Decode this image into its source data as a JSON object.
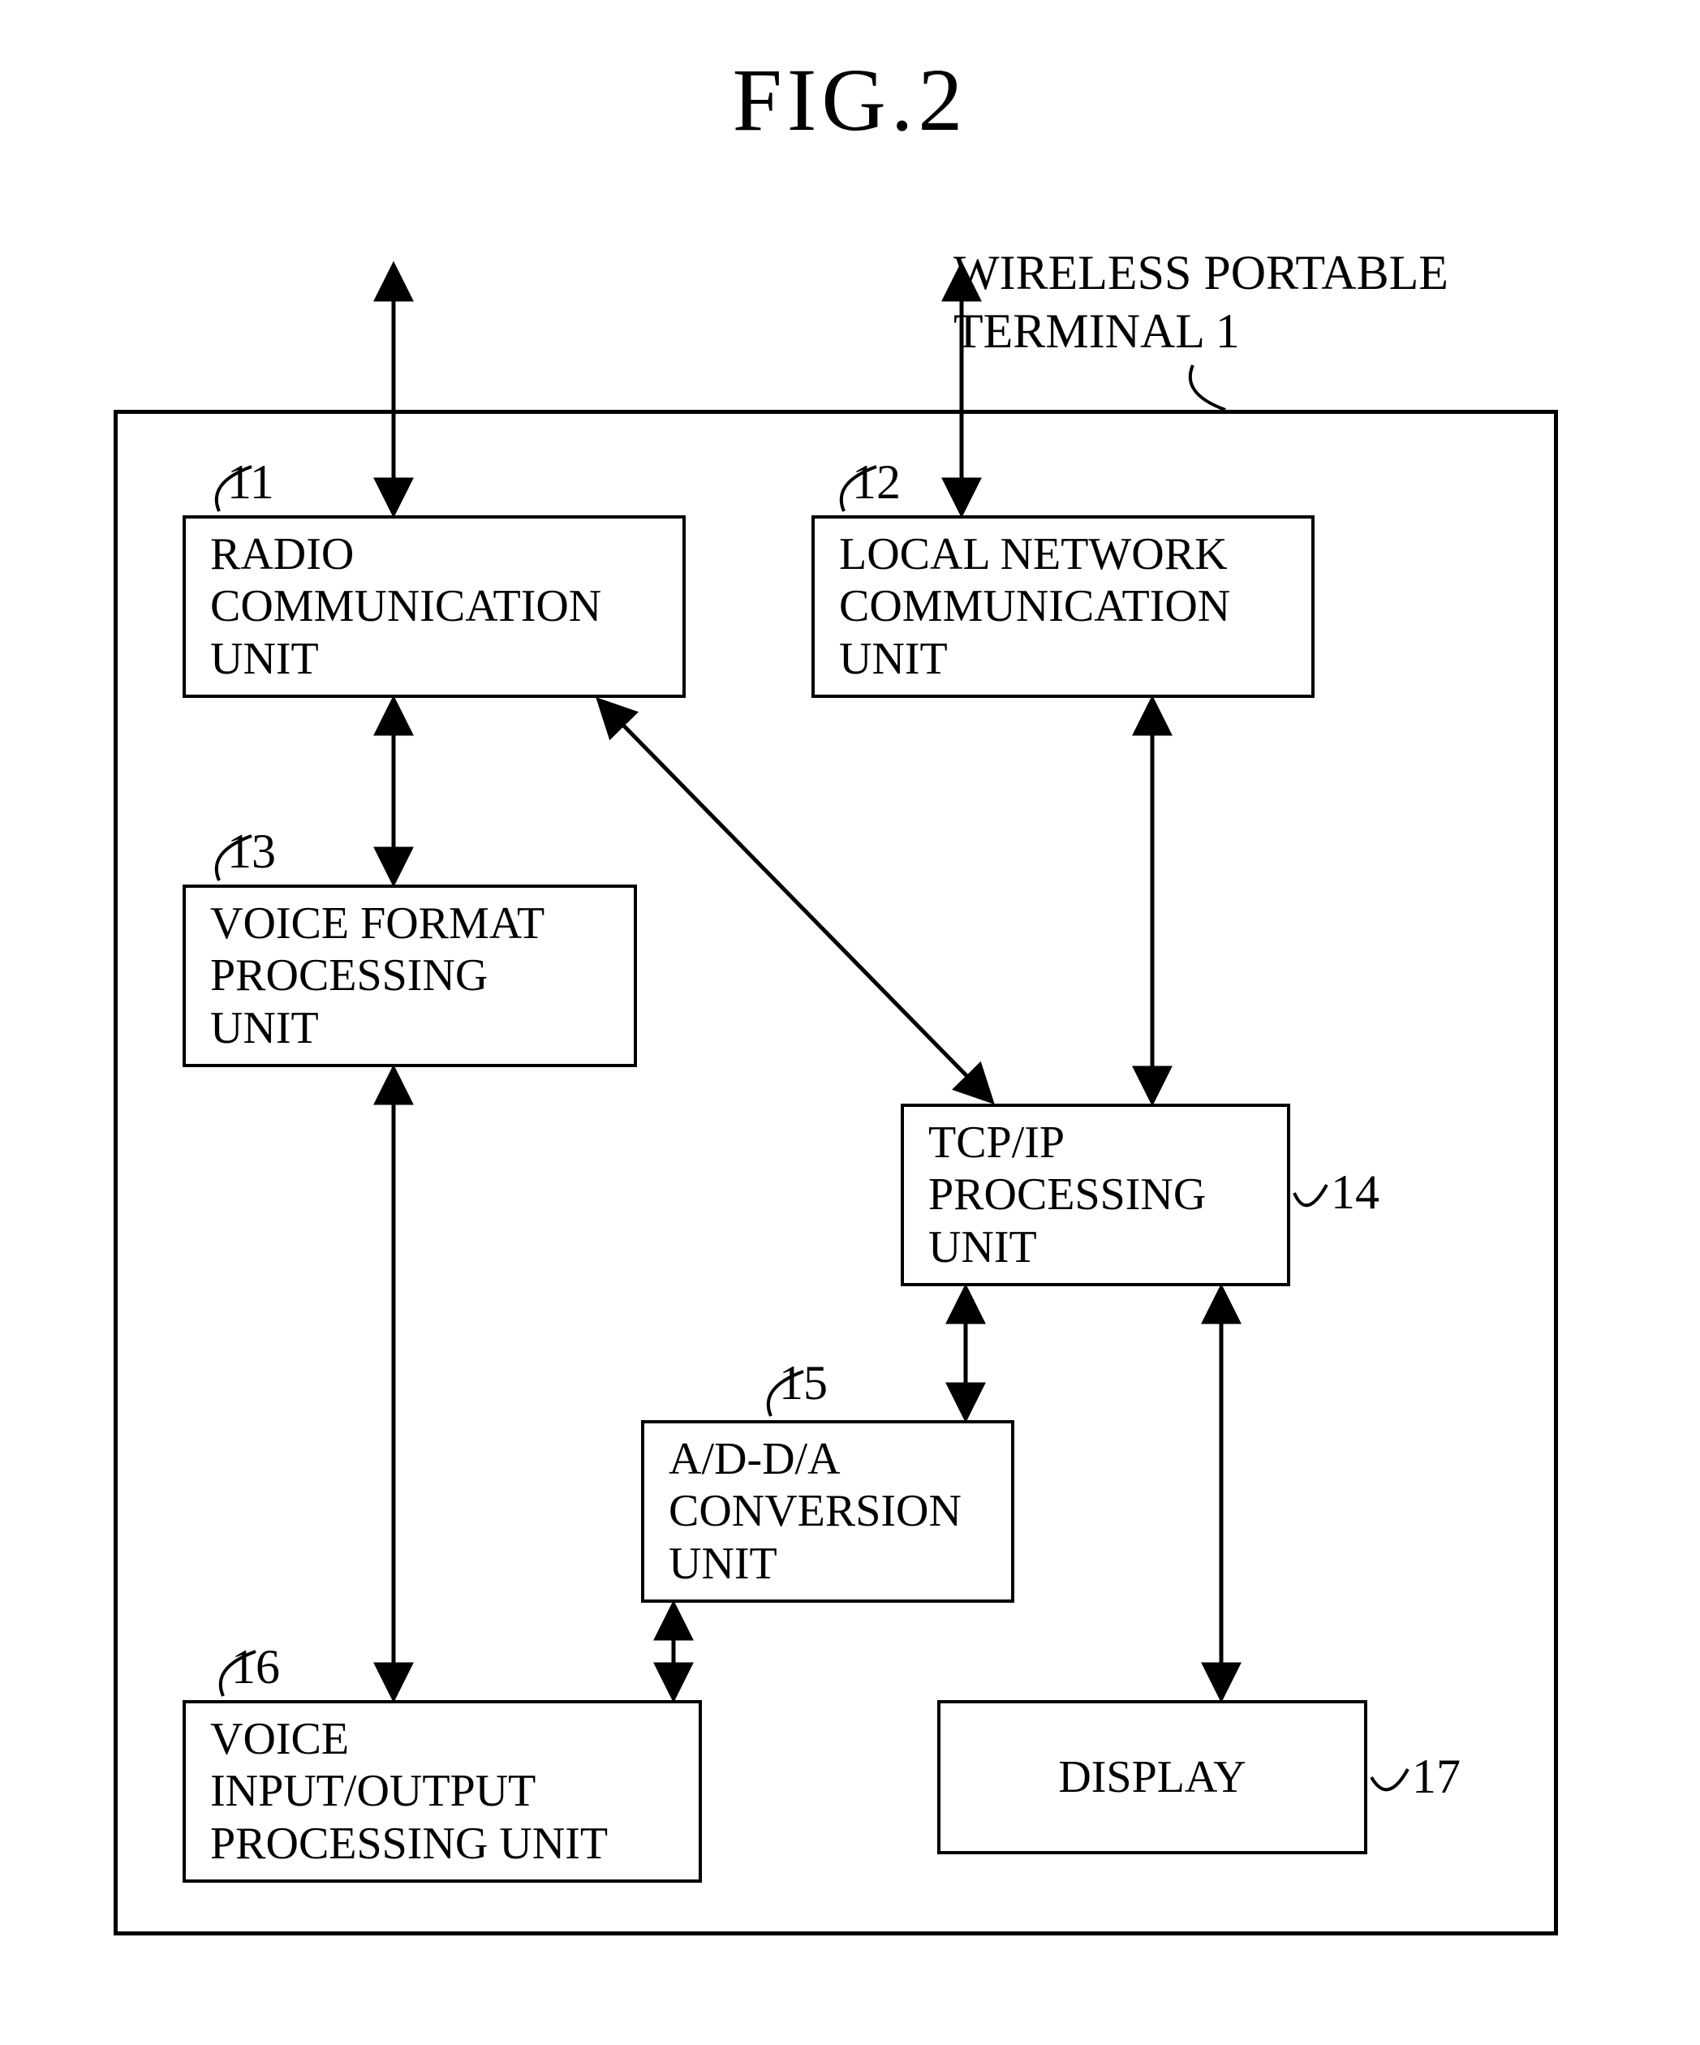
{
  "figure_title": "FIG.2",
  "outer_label": "WIRELESS  PORTABLE\nTERMINAL  1",
  "blocks": {
    "b11": {
      "num": "11",
      "text": "RADIO\nCOMMUNICATION\nUNIT"
    },
    "b12": {
      "num": "12",
      "text": "LOCAL  NETWORK\nCOMMUNICATION\nUNIT"
    },
    "b13": {
      "num": "13",
      "text": "VOICE  FORMAT\nPROCESSING\nUNIT"
    },
    "b14": {
      "num": "14",
      "text": "TCP/IP\nPROCESSING\nUNIT"
    },
    "b15": {
      "num": "15",
      "text": "A/D-D/A\nCONVERSION\nUNIT"
    },
    "b16": {
      "num": "16",
      "text": "VOICE\nINPUT/OUTPUT\nPROCESSING  UNIT"
    },
    "b17": {
      "num": "17",
      "text": "DISPLAY"
    }
  }
}
